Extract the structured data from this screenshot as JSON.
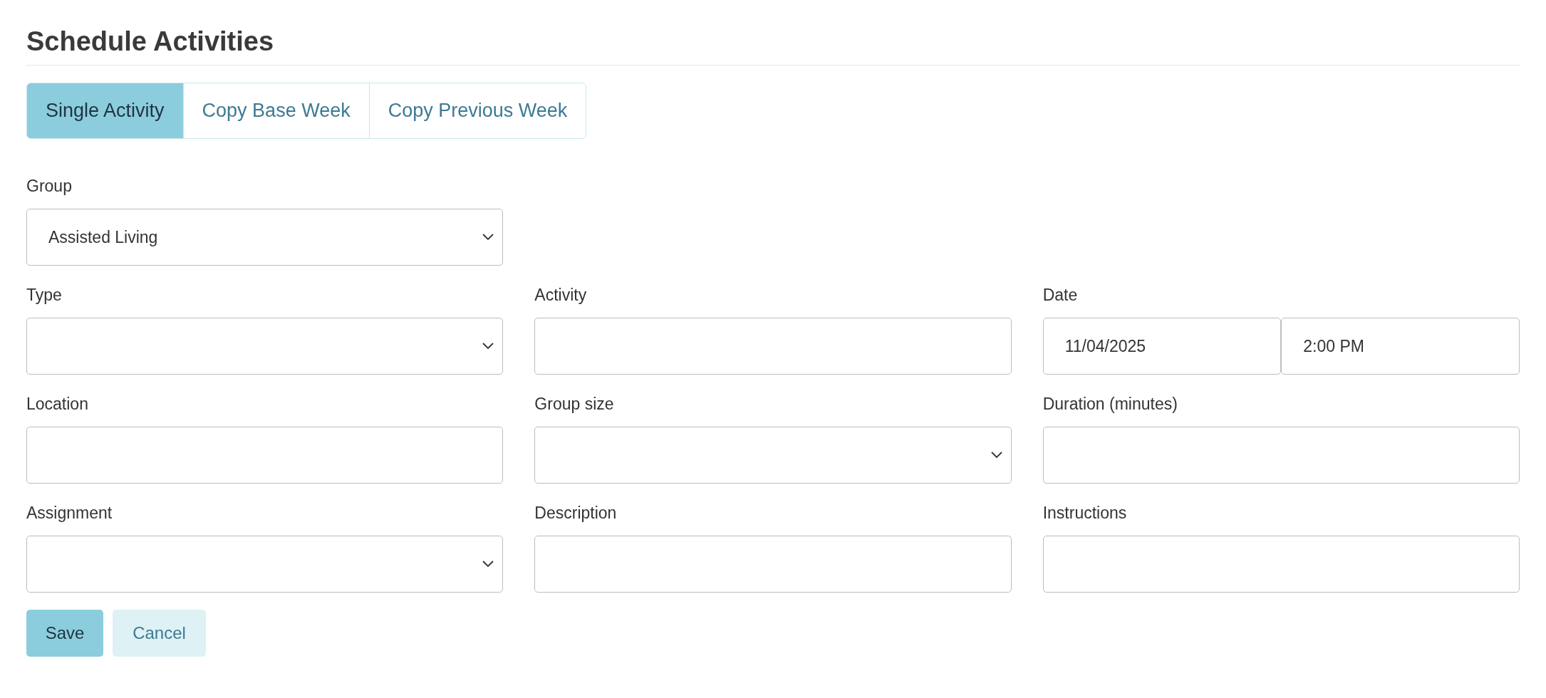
{
  "title": "Schedule Activities",
  "tabs": [
    {
      "label": "Single Activity",
      "selected": true
    },
    {
      "label": "Copy Base Week",
      "selected": false
    },
    {
      "label": "Copy Previous Week",
      "selected": false
    }
  ],
  "rows": [
    [
      {
        "label": "Group",
        "kind": "select",
        "value": "Assisted Living"
      }
    ],
    [
      {
        "label": "Type",
        "kind": "select"
      },
      {
        "label": "Activity",
        "kind": "text"
      },
      {
        "label": "Date",
        "kind": "datetime",
        "values": [
          "11/04/2025",
          "2:00 PM"
        ]
      }
    ],
    [
      {
        "label": "Location",
        "kind": "text"
      },
      {
        "label": "Group size",
        "kind": "select"
      },
      {
        "label": "Duration (minutes)",
        "kind": "text"
      }
    ],
    [
      {
        "label": "Assignment",
        "kind": "select"
      },
      {
        "label": "Description",
        "kind": "text"
      },
      {
        "label": "Instructions",
        "kind": "text"
      }
    ]
  ],
  "buttons": [
    {
      "label": "Save",
      "kind": "primary"
    },
    {
      "label": "Cancel",
      "kind": "secondary"
    }
  ]
}
